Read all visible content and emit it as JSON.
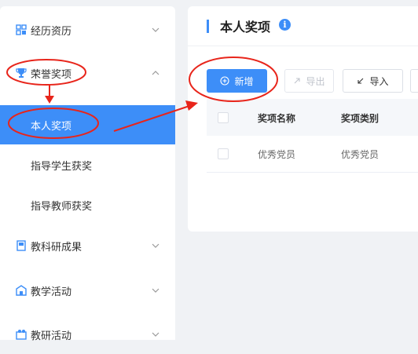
{
  "sidebar": {
    "items": [
      {
        "label": "经历资历",
        "icon": "grid-icon",
        "expanded": false
      },
      {
        "label": "荣誉奖项",
        "icon": "trophy-icon",
        "expanded": true
      },
      {
        "label": "本人奖项",
        "active": true
      },
      {
        "label": "指导学生获奖"
      },
      {
        "label": "指导教师获奖"
      },
      {
        "label": "教科研成果",
        "icon": "book-icon",
        "expanded": false
      },
      {
        "label": "教学活动",
        "icon": "school-icon",
        "expanded": false
      },
      {
        "label": "教研活动",
        "icon": "research-icon",
        "expanded": false
      }
    ]
  },
  "main": {
    "title": "本人奖项",
    "info_glyph": "i",
    "toolbar": {
      "add_label": "新增",
      "export_label": "导出",
      "import_label": "导入"
    },
    "table": {
      "columns": [
        "奖项名称",
        "奖项类别"
      ],
      "rows": [
        [
          "优秀党员",
          "优秀党员"
        ]
      ]
    }
  },
  "colors": {
    "accent": "#3d8ef8",
    "annotation": "#e8251b"
  }
}
